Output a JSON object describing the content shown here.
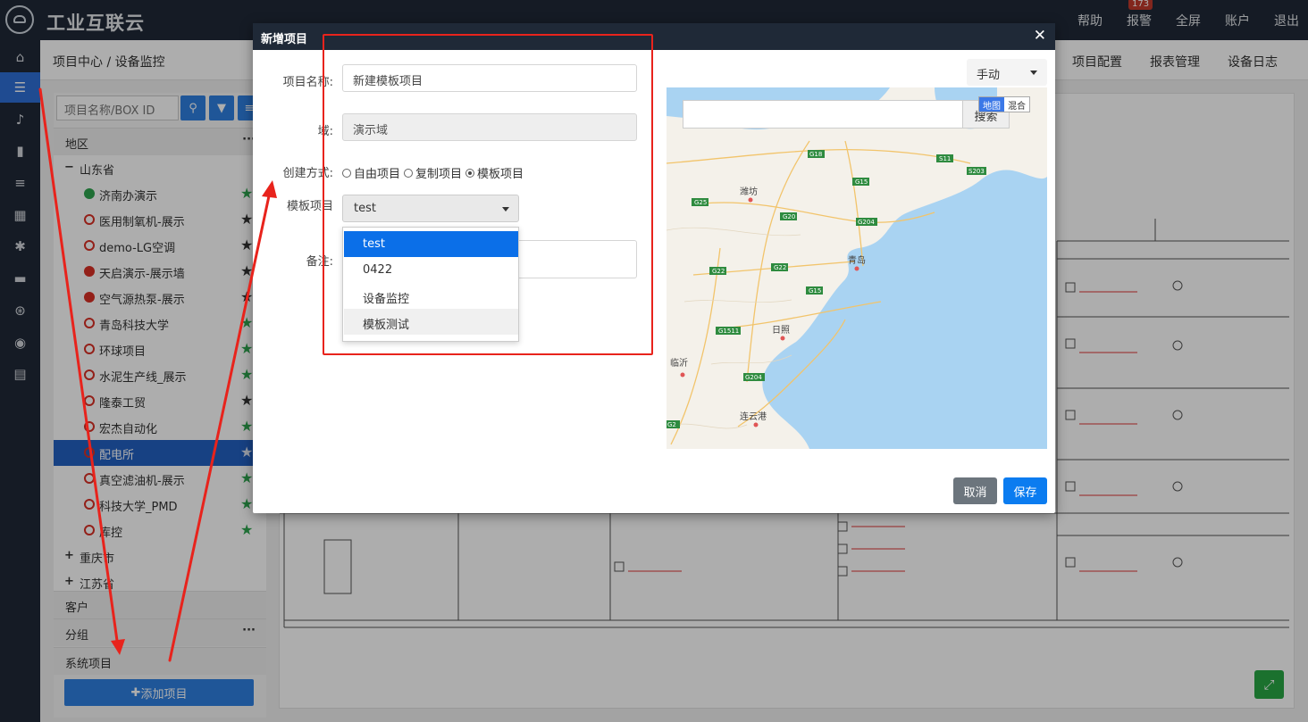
{
  "app": {
    "brand": "工业互联云",
    "nav": [
      {
        "label": "帮助"
      },
      {
        "label": "报警",
        "badge": "173"
      },
      {
        "label": "全屏"
      },
      {
        "label": "账户"
      },
      {
        "label": "退出"
      }
    ]
  },
  "subheader": {
    "breadcrumb": "项目中心 / 设备监控",
    "tabs": [
      "项目配置",
      "报表管理",
      "设备日志"
    ]
  },
  "sidebar": {
    "search_placeholder": "项目名称/BOX ID",
    "sections": {
      "region": "地区",
      "customer": "客户",
      "group": "分组",
      "system": "系统项目"
    },
    "tree": [
      {
        "label": "山东省",
        "type": "province",
        "expanded": true
      },
      {
        "label": "济南办演示",
        "status": "online",
        "starred": true
      },
      {
        "label": "医用制氧机-展示",
        "status": "offline",
        "starred": false
      },
      {
        "label": "demo-LG空调",
        "status": "offline",
        "starred": false
      },
      {
        "label": "天启演示-展示墙",
        "status": "alarm",
        "starred": false
      },
      {
        "label": "空气源热泵-展示",
        "status": "alarm",
        "starred": false
      },
      {
        "label": "青岛科技大学",
        "status": "offline",
        "starred": true
      },
      {
        "label": "环球项目",
        "status": "offline",
        "starred": true
      },
      {
        "label": "水泥生产线_展示",
        "status": "offline",
        "starred": true
      },
      {
        "label": "隆泰工贸",
        "status": "offline",
        "starred": false
      },
      {
        "label": "宏杰自动化",
        "status": "offline",
        "starred": true
      },
      {
        "label": "配电所",
        "status": "offline",
        "starred": true,
        "selected": true
      },
      {
        "label": "真空滤油机-展示",
        "status": "offline",
        "starred": true
      },
      {
        "label": "科技大学_PMD",
        "status": "offline",
        "starred": true
      },
      {
        "label": "库控",
        "status": "offline",
        "starred": true
      },
      {
        "label": "重庆市",
        "type": "province",
        "expanded": false
      },
      {
        "label": "江苏省",
        "type": "province",
        "expanded": false
      }
    ],
    "add_button": "添加项目"
  },
  "modal": {
    "title": "新增项目",
    "fields": {
      "name_label": "项目名称:",
      "name_value": "新建模板项目",
      "domain_label": "域:",
      "domain_value": "演示域",
      "create_label": "创建方式:",
      "create_options": [
        "自由项目",
        "复制项目",
        "模板项目"
      ],
      "create_selected": "模板项目",
      "template_label": "模板项目",
      "template_value": "test",
      "template_options": [
        "test",
        "0422",
        "设备监控",
        "模板测试"
      ],
      "template_highlighted": "test",
      "remark_label": "备注:"
    },
    "map": {
      "mode": "手动",
      "search_button": "搜索",
      "type_options": [
        "地图",
        "混合"
      ],
      "type_selected": "地图",
      "cities": [
        "潍坊",
        "青岛",
        "日照",
        "临沂",
        "连云港"
      ],
      "roads": [
        "G18",
        "S11",
        "S203",
        "G15",
        "G25",
        "G20",
        "G204",
        "G22",
        "G22",
        "G15",
        "G1511",
        "G204",
        "G2"
      ]
    },
    "buttons": {
      "cancel": "取消",
      "save": "保存"
    }
  },
  "colors": {
    "topbar": "#1f2937",
    "accent": "#2f7fe0",
    "highlight": "#0b6fe8",
    "annotation": "#e8231c"
  }
}
